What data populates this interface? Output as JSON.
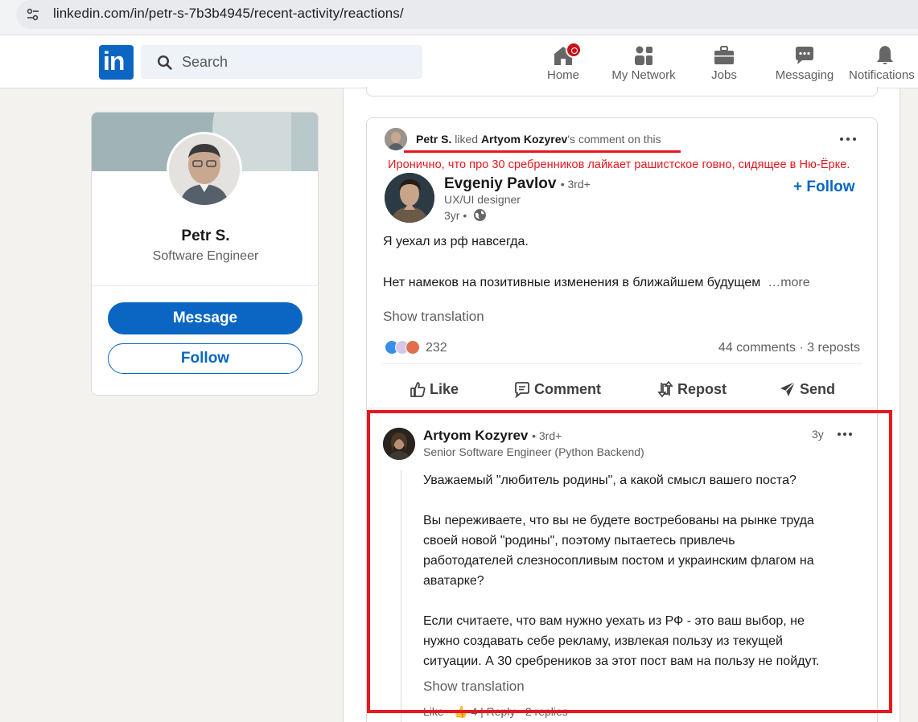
{
  "browser": {
    "url": "linkedin.com/in/petr-s-7b3b4945/recent-activity/reactions/"
  },
  "header": {
    "logo": "in",
    "search_placeholder": "Search",
    "nav": [
      {
        "label": "Home",
        "icon": "home-icon"
      },
      {
        "label": "My Network",
        "icon": "network-icon"
      },
      {
        "label": "Jobs",
        "icon": "briefcase-icon"
      },
      {
        "label": "Messaging",
        "icon": "messaging-icon"
      },
      {
        "label": "Notifications",
        "icon": "bell-icon"
      }
    ]
  },
  "profile": {
    "name": "Petr S.",
    "headline": "Software Engineer",
    "message_label": "Message",
    "follow_label": "Follow"
  },
  "activity": {
    "actor": "Petr S.",
    "verb": " liked ",
    "target": "Artyom Kozyrev",
    "rest": "'s comment on this"
  },
  "annotation": "Иронично, что про 30 сребренников лайкает рашистское говно, сидящее в Ню-Ёрке.",
  "post": {
    "author": "Evgeniy Pavlov",
    "degree": "• 3rd+",
    "headline": "UX/UI designer",
    "time": "3yr •",
    "follow_label": "+ Follow",
    "line1": "Я уехал из рф навсегда.",
    "line2": "Нет намеков на позитивные изменения в ближайшем будущем",
    "more": "…more",
    "show_translation": "Show translation",
    "reaction_count": "232",
    "comments_reposts": "44 comments · 3 reposts",
    "actions": {
      "like": "Like",
      "comment": "Comment",
      "repost": "Repost",
      "send": "Send"
    }
  },
  "comment": {
    "author": "Artyom Kozyrev",
    "degree": "• 3rd+",
    "headline": "Senior Software Engineer (Python Backend)",
    "time": "3y",
    "p1": "Уважаемый \"любитель родины\", а какой смысл вашего поста?",
    "p2": [
      "Вы переживаете, что вы не будете востребованы на рынке труда",
      "своей новой \"родины\", поэтому пытаетесь привлечь",
      "работодателей слезносопливым постом и украинским флагом на",
      "аватарке?"
    ],
    "p3": [
      "Если считаете, что вам нужно уехать из РФ - это ваш выбор, не",
      "нужно создавать себе рекламу, извлекая пользу из текущей",
      "ситуации. А 30 сребреников за этот пост вам на пользу не пойдут."
    ],
    "show_translation": "Show translation",
    "footer": "Like · 👍 4 | Reply · 2 replies"
  },
  "colors": {
    "brand": "#0a66c2",
    "highlight": "#e8171f"
  }
}
